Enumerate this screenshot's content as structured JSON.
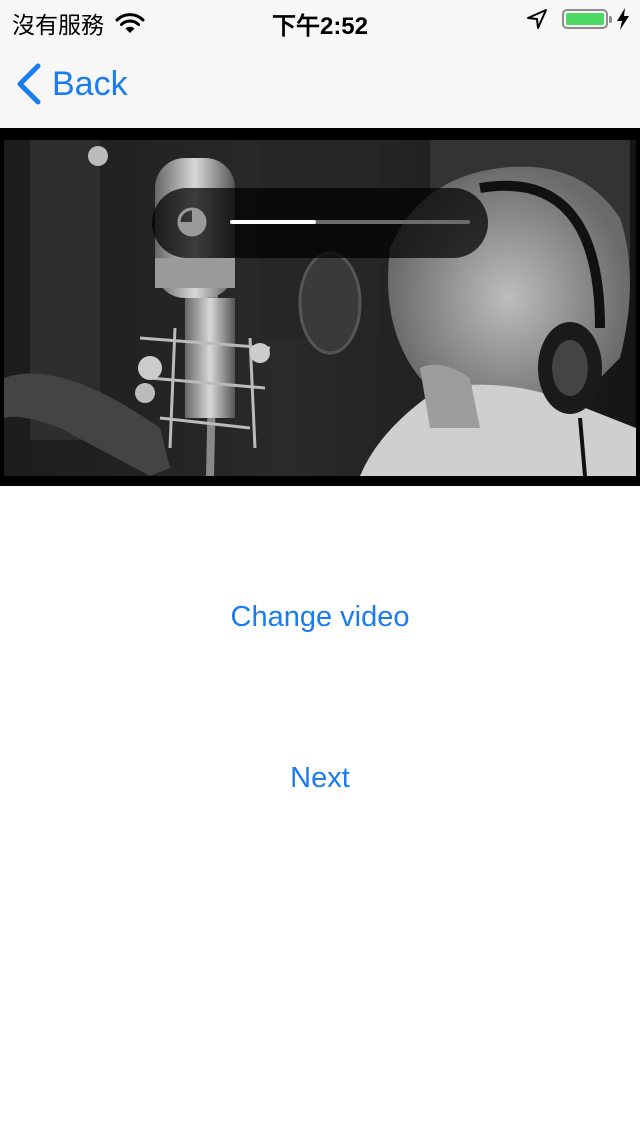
{
  "status_bar": {
    "carrier": "沒有服務",
    "time": "下午2:52",
    "battery_level": 1.0,
    "battery_color": "#4cd964"
  },
  "nav": {
    "back_label": "Back"
  },
  "video": {
    "progress": 0.36
  },
  "buttons": {
    "change_video": "Change video",
    "next": "Next"
  },
  "colors": {
    "accent": "#1a7cf0"
  },
  "icons": {
    "wifi": "wifi-icon",
    "location": "location-arrow-icon",
    "battery": "battery-icon",
    "charging": "charging-bolt-icon",
    "back": "chevron-left-icon",
    "spinner": "loading-spinner-icon"
  }
}
